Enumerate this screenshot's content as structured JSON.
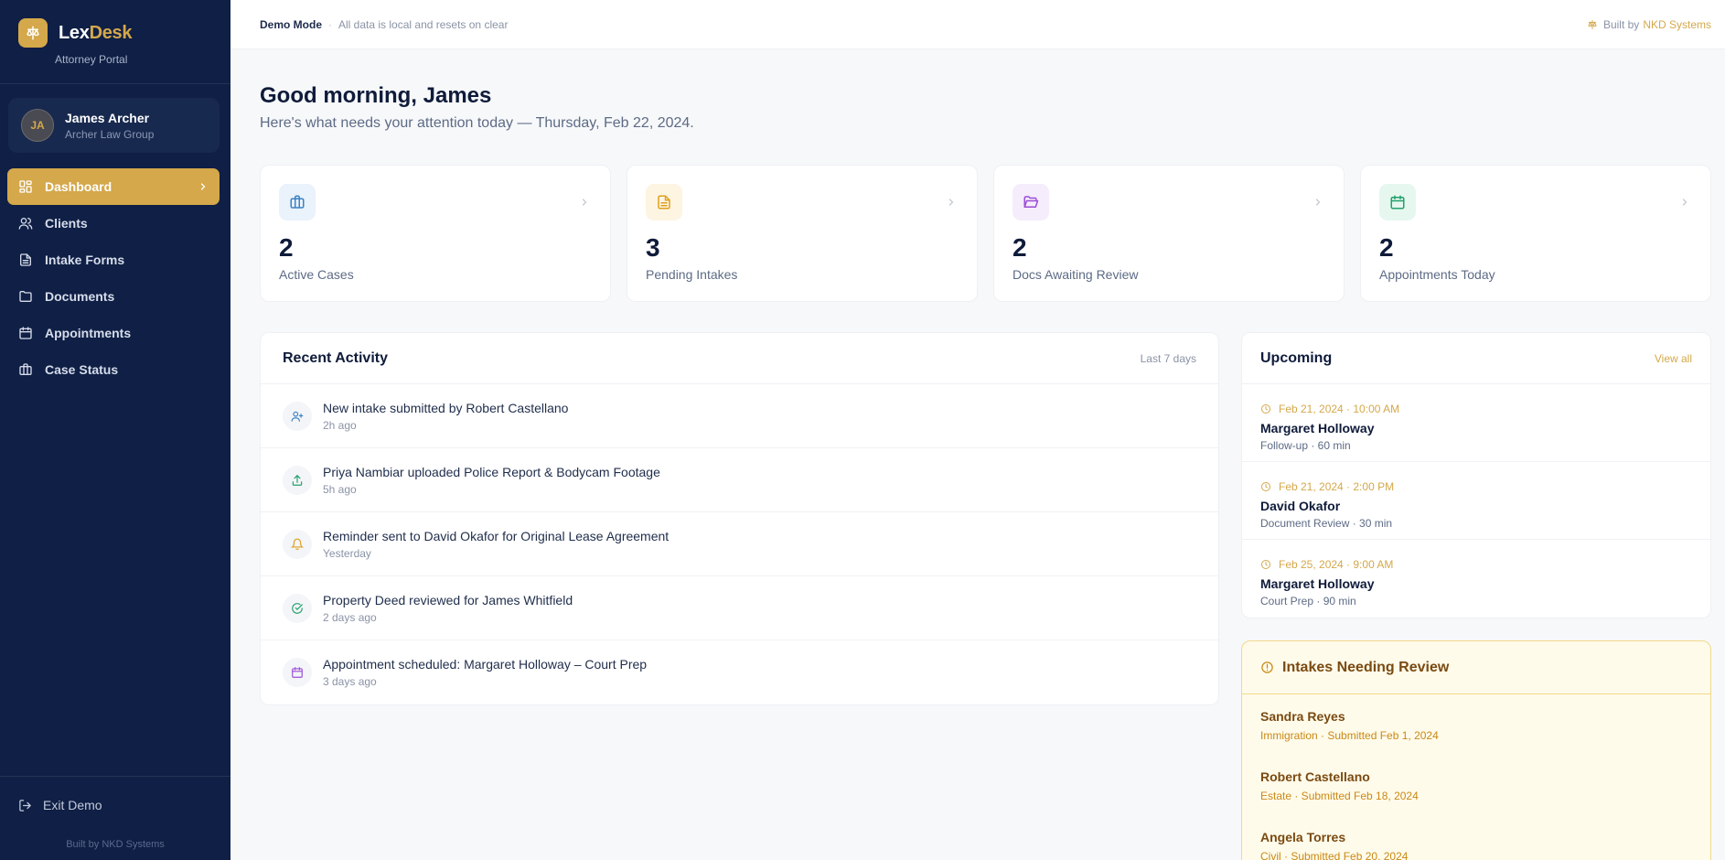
{
  "brand": {
    "name_part1": "Lex",
    "name_part2": "Desk",
    "subtitle": "Attorney Portal"
  },
  "user": {
    "initials": "JA",
    "name": "James Archer",
    "firm": "Archer Law Group"
  },
  "nav": [
    {
      "label": "Dashboard",
      "icon": "layout-dashboard-icon",
      "active": true
    },
    {
      "label": "Clients",
      "icon": "users-icon"
    },
    {
      "label": "Intake Forms",
      "icon": "file-text-icon"
    },
    {
      "label": "Documents",
      "icon": "folder-icon"
    },
    {
      "label": "Appointments",
      "icon": "calendar-icon"
    },
    {
      "label": "Case Status",
      "icon": "briefcase-icon"
    }
  ],
  "sidebar_footer": {
    "exit_label": "Exit Demo",
    "built_by": "Built by NKD Systems"
  },
  "topbar": {
    "mode": "Demo Mode",
    "separator": "·",
    "note": "All data is local and resets on clear",
    "built_prefix": "Built by",
    "built_name": "NKD Systems"
  },
  "greeting": {
    "title": "Good morning, James",
    "subtitle": "Here's what needs your attention today — Thursday, Feb 22, 2024."
  },
  "stats": [
    {
      "value": "2",
      "label": "Active Cases",
      "icon": "briefcase-icon",
      "color": "#3b82c4",
      "bg": "#eaf2fb"
    },
    {
      "value": "3",
      "label": "Pending Intakes",
      "icon": "file-text-icon",
      "color": "#e0a020",
      "bg": "#fdf5e2"
    },
    {
      "value": "2",
      "label": "Docs Awaiting Review",
      "icon": "folder-open-icon",
      "color": "#9b4dd6",
      "bg": "#f5ecfc"
    },
    {
      "value": "2",
      "label": "Appointments Today",
      "icon": "calendar-icon",
      "color": "#22a06b",
      "bg": "#e6f7ef"
    }
  ],
  "activity": {
    "title": "Recent Activity",
    "range": "Last 7 days",
    "items": [
      {
        "text": "New intake submitted by Robert Castellano",
        "time": "2h ago",
        "icon": "user-plus-icon",
        "color": "#3b82c4"
      },
      {
        "text": "Priya Nambiar uploaded Police Report & Bodycam Footage",
        "time": "5h ago",
        "icon": "upload-icon",
        "color": "#22a06b"
      },
      {
        "text": "Reminder sent to David Okafor for Original Lease Agreement",
        "time": "Yesterday",
        "icon": "bell-icon",
        "color": "#e0a020"
      },
      {
        "text": "Property Deed reviewed for James Whitfield",
        "time": "2 days ago",
        "icon": "check-circle-icon",
        "color": "#22a06b"
      },
      {
        "text": "Appointment scheduled: Margaret Holloway – Court Prep",
        "time": "3 days ago",
        "icon": "calendar-icon",
        "color": "#9b4dd6"
      }
    ]
  },
  "upcoming": {
    "title": "Upcoming",
    "link": "View all",
    "items": [
      {
        "time": "Feb 21, 2024 · 10:00 AM",
        "name": "Margaret Holloway",
        "detail": "Follow-up · 60 min"
      },
      {
        "time": "Feb 21, 2024 · 2:00 PM",
        "name": "David Okafor",
        "detail": "Document Review · 30 min"
      },
      {
        "time": "Feb 25, 2024 · 9:00 AM",
        "name": "Margaret Holloway",
        "detail": "Court Prep · 90 min"
      }
    ]
  },
  "review": {
    "title": "Intakes Needing Review",
    "items": [
      {
        "name": "Sandra Reyes",
        "meta": "Immigration · Submitted Feb 1, 2024"
      },
      {
        "name": "Robert Castellano",
        "meta": "Estate · Submitted Feb 18, 2024"
      },
      {
        "name": "Angela Torres",
        "meta": "Civil · Submitted Feb 20, 2024"
      }
    ]
  },
  "colors": {
    "navy": "#0f1f45",
    "gold": "#d4a84b",
    "background": "#f7f8fa"
  }
}
